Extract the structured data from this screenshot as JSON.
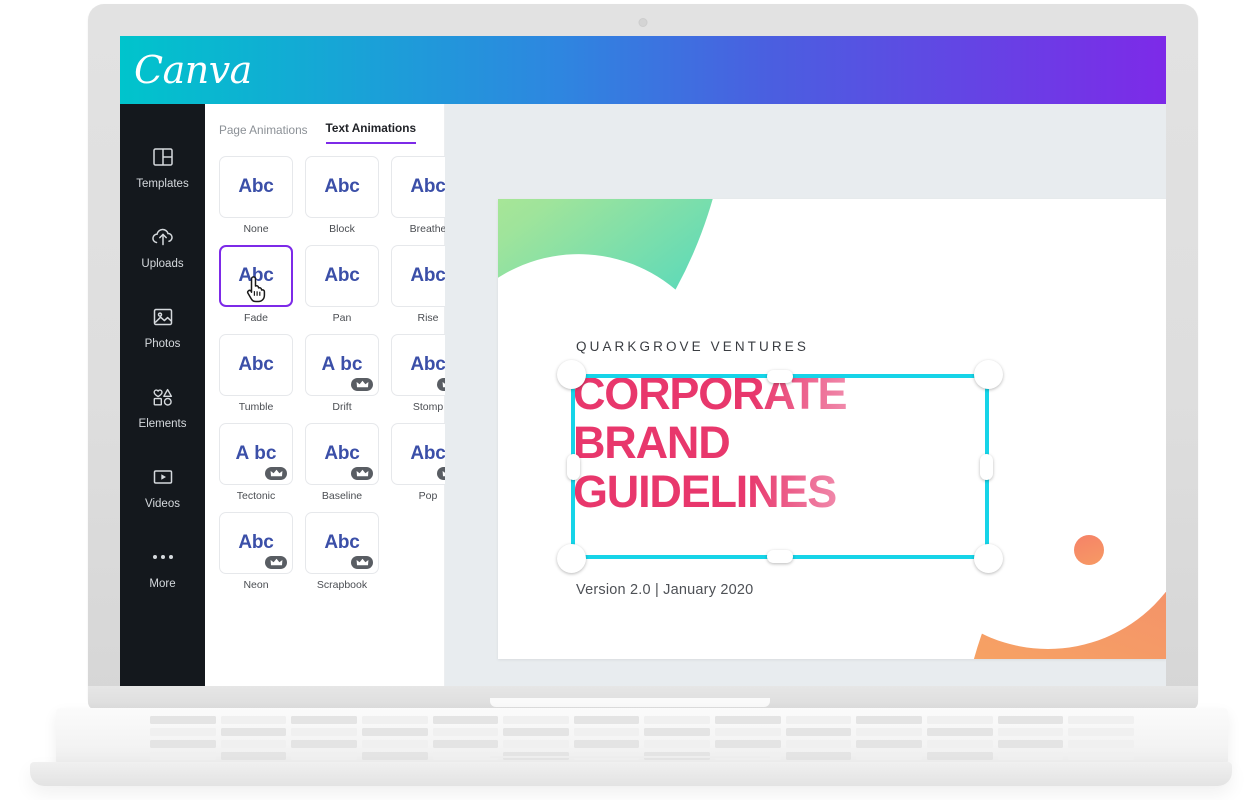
{
  "app": {
    "brand": "Canva",
    "header_gradient_from": "#00c4cc",
    "header_gradient_to": "#7d2ae8"
  },
  "sidebar": {
    "items": [
      {
        "label": "Templates",
        "icon": "templates-icon"
      },
      {
        "label": "Uploads",
        "icon": "upload-cloud-icon"
      },
      {
        "label": "Photos",
        "icon": "photo-icon"
      },
      {
        "label": "Elements",
        "icon": "shapes-icon"
      },
      {
        "label": "Videos",
        "icon": "video-play-icon"
      },
      {
        "label": "More",
        "icon": "more-dots-icon"
      }
    ]
  },
  "panel": {
    "tabs": [
      {
        "label": "Page Animations",
        "active": false
      },
      {
        "label": "Text Animations",
        "active": true
      }
    ],
    "accent_color": "#7d2ae8",
    "preview_text": "Abc",
    "pro_badge_icon": "crown-icon",
    "cursor_icon": "pointing-hand-cursor",
    "animations": [
      {
        "label": "None",
        "pro": false,
        "selected": false,
        "style": "normal"
      },
      {
        "label": "Block",
        "pro": false,
        "selected": false,
        "style": "normal"
      },
      {
        "label": "Breathe",
        "pro": false,
        "selected": false,
        "style": "normal"
      },
      {
        "label": "Fade",
        "pro": false,
        "selected": true,
        "style": "normal"
      },
      {
        "label": "Pan",
        "pro": false,
        "selected": false,
        "style": "normal"
      },
      {
        "label": "Rise",
        "pro": false,
        "selected": false,
        "style": "normal"
      },
      {
        "label": "Tumble",
        "pro": false,
        "selected": false,
        "style": "normal"
      },
      {
        "label": "Drift",
        "pro": true,
        "selected": false,
        "style": "split"
      },
      {
        "label": "Stomp",
        "pro": true,
        "selected": false,
        "style": "normal"
      },
      {
        "label": "Tectonic",
        "pro": true,
        "selected": false,
        "style": "split"
      },
      {
        "label": "Baseline",
        "pro": true,
        "selected": false,
        "style": "normal"
      },
      {
        "label": "Pop",
        "pro": true,
        "selected": false,
        "style": "normal"
      },
      {
        "label": "Neon",
        "pro": true,
        "selected": false,
        "style": "normal"
      },
      {
        "label": "Scrapbook",
        "pro": true,
        "selected": false,
        "style": "normal"
      }
    ]
  },
  "slide": {
    "eyebrow": "QUARKGROVE VENTURES",
    "headline": "CORPORATE\nBRAND\nGUIDELINES",
    "version": "Version 2.0 | January 2020",
    "headline_color": "#e8376c",
    "selection_color": "#16d4e8",
    "blob_green_from": "#d3f07f",
    "blob_green_to": "#35cfc8",
    "blob_orange_from": "#ef6a62",
    "blob_orange_to": "#f8b05e"
  }
}
